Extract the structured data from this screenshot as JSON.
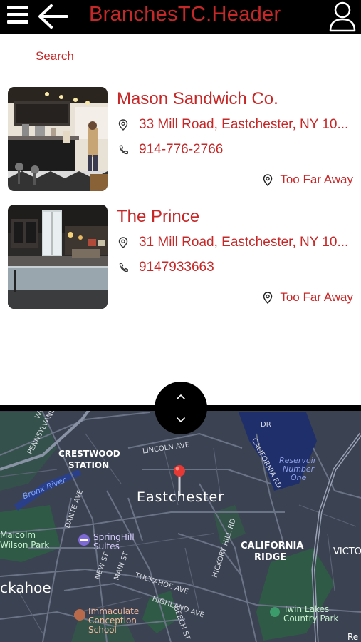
{
  "header": {
    "title": "BranchesTC.Header"
  },
  "search": {
    "label": "Search"
  },
  "restaurants": [
    {
      "name": "Mason Sandwich Co.",
      "address": "33 Mill Road, Eastchester, NY 10...",
      "phone": "914-776-2766",
      "distance": "Too Far Away"
    },
    {
      "name": "The Prince",
      "address": "31 Mill Road, Eastchester, NY 10...",
      "phone": "9147933663",
      "distance": "Too Far Away"
    }
  ],
  "map": {
    "labels": {
      "pennsylvania_ave": "PENNSYLVANIA",
      "crestwood": "CRESTWOOD",
      "station": "STATION",
      "lincoln_ave": "LINCOLN AVE",
      "bronx_river": "Bronx River",
      "dante_ave": "DANTE AVE",
      "eastchester": "Eastchester",
      "california_rd": "CALIFORNIA RD",
      "reservoir": "Reservoir",
      "number": "Number",
      "one": "One",
      "malcolm": "Malcolm",
      "wilson_park": "Wilson Park",
      "springhill": "SpringHill",
      "suites": "Suites",
      "hickory_hill_rd": "HICKORY HILL RD",
      "california": "CALIFORNIA",
      "ridge": "RIDGE",
      "victo": "VICTO",
      "new_st": "NEW ST",
      "main_st": "MAIN ST",
      "tuckahoe_ave": "TUCKAHOE AVE",
      "ckahoe": "ckahoe",
      "highland_ave": "HIGHLAND AVE",
      "twin_lakes": "Twin Lakes",
      "country_park": "Country Park",
      "immaculate": "Immaculate",
      "conception": "Conception",
      "school": "School",
      "beech_st": "BEECH ST",
      "re": "Re",
      "we": "WE",
      "dr": "DR"
    },
    "colors": {
      "land": "#3b4252",
      "water": "#1f2f6b",
      "park": "#2f5a45",
      "road": "#6b7386",
      "pin": "#e53935"
    }
  },
  "colors": {
    "accent": "#c62828",
    "header_bg": "#000000"
  }
}
